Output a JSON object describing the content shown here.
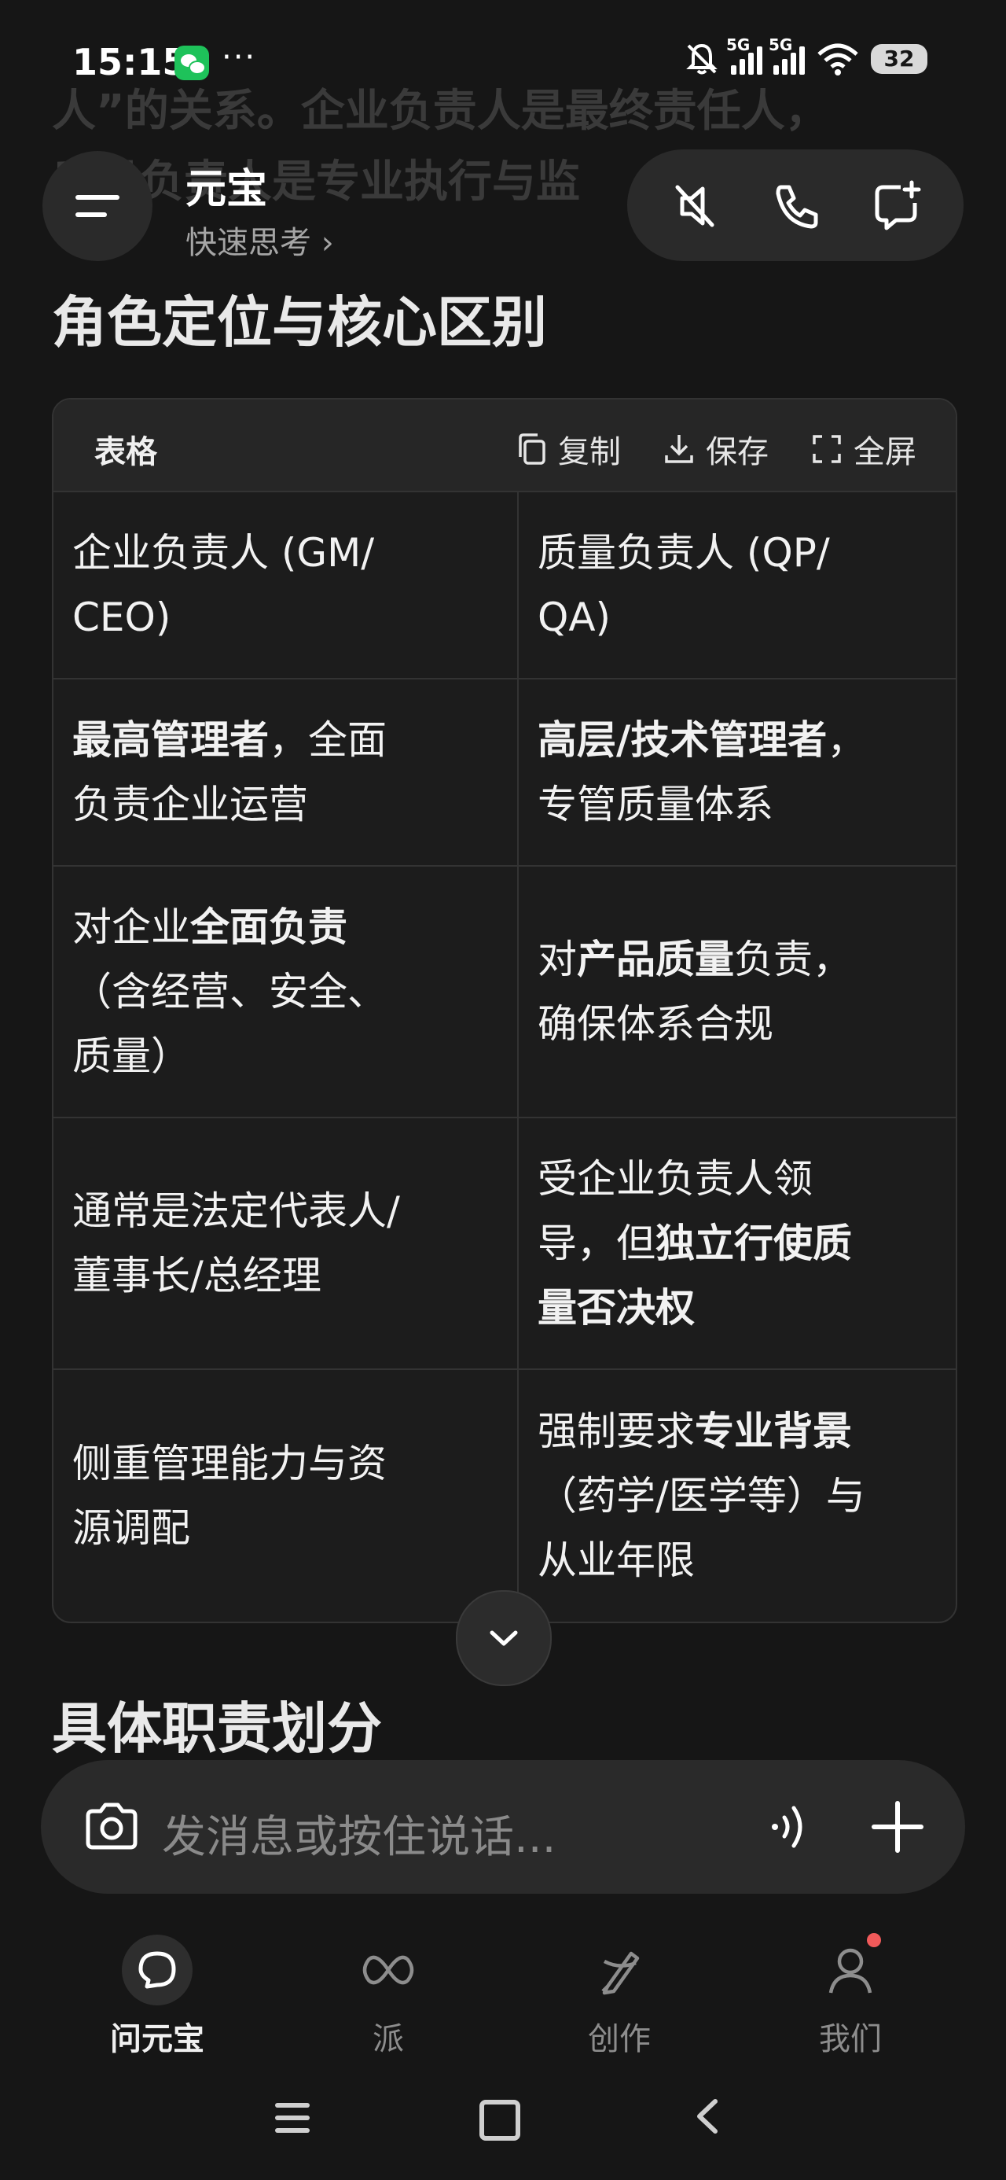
{
  "status_bar": {
    "time": "15:15",
    "more": "···",
    "signal1_tag": "5G",
    "signal2_tag": "5G",
    "battery": "32",
    "icons": [
      "wechat-icon",
      "mute-bell-icon",
      "signal-icon",
      "wifi-icon",
      "battery-icon"
    ]
  },
  "background_text": {
    "line1": "人”的关系。企业负责人是最终责任人，",
    "line2": "质量负责人是专业执行与监"
  },
  "header": {
    "title": "元宝",
    "mode": "快速思考 ›",
    "icons": [
      "menu-icon",
      "mute-speaker-icon",
      "phone-icon",
      "new-chat-icon"
    ]
  },
  "section1": {
    "heading": "角色定位与核心区别"
  },
  "table": {
    "label": "表格",
    "copy_label": "复制",
    "save_label": "保存",
    "fullscreen_label": "全屏",
    "rows": [
      {
        "c1": [
          {
            "t": "企业负责人 (GM/",
            "b": false
          },
          {
            "t": "CEO)",
            "b": false,
            "br": true
          }
        ],
        "c2": [
          {
            "t": "质量负责人 (QP/",
            "b": false
          },
          {
            "t": "QA)",
            "b": false,
            "br": true
          }
        ]
      },
      {
        "c1": [
          {
            "t": "最高管理者",
            "b": true
          },
          {
            "t": "，全面",
            "b": false
          },
          {
            "t": "负责企业运营",
            "b": false,
            "br": true
          }
        ],
        "c2": [
          {
            "t": "高层/技术管理者",
            "b": true
          },
          {
            "t": "，",
            "b": false
          },
          {
            "t": "专管质量体系",
            "b": false,
            "br": true
          }
        ]
      },
      {
        "c1": [
          {
            "t": "对企业",
            "b": false
          },
          {
            "t": "全面负责",
            "b": true
          },
          {
            "t": "（含经营、安全、",
            "b": false,
            "br": true
          },
          {
            "t": "质量）",
            "b": false,
            "br": true
          }
        ],
        "c2": [
          {
            "t": "对",
            "b": false
          },
          {
            "t": "产品质量",
            "b": true
          },
          {
            "t": "负责，",
            "b": false
          },
          {
            "t": "确保体系合规",
            "b": false,
            "br": true
          }
        ]
      },
      {
        "c1": [
          {
            "t": "通常是法定代表人/",
            "b": false
          },
          {
            "t": "董事长/总经理",
            "b": false,
            "br": true
          }
        ],
        "c2": [
          {
            "t": "受企业负责人领",
            "b": false
          },
          {
            "t": "导，但",
            "b": false,
            "br": true
          },
          {
            "t": "独立行使质",
            "b": true
          },
          {
            "t": "量否决权",
            "b": true,
            "br": true
          }
        ]
      },
      {
        "c1": [
          {
            "t": "侧重管理能力与资",
            "b": false
          },
          {
            "t": "源调配",
            "b": false,
            "br": true
          }
        ],
        "c2": [
          {
            "t": "强制要求",
            "b": false
          },
          {
            "t": "专业背景",
            "b": true
          },
          {
            "t": "（药学/医学等）与",
            "b": false,
            "br": true
          },
          {
            "t": "从业年限",
            "b": false,
            "br": true
          }
        ]
      }
    ]
  },
  "section2": {
    "heading": "具体职责划分"
  },
  "input": {
    "placeholder": "发消息或按住说话...",
    "icons": [
      "camera-icon",
      "voice-wave-icon",
      "plus-icon"
    ]
  },
  "bottom_nav": {
    "items": [
      {
        "label": "问元宝",
        "icon": "chat-bubble-icon",
        "active": true
      },
      {
        "label": "派",
        "icon": "infinity-icon",
        "active": false
      },
      {
        "label": "创作",
        "icon": "pen-star-icon",
        "active": false
      },
      {
        "label": "我们",
        "icon": "person-icon",
        "active": false,
        "badge": true
      }
    ]
  },
  "colors": {
    "background": "#161616",
    "card": "#1c1c1c",
    "badge": "#f05a5a",
    "wechat": "#1ec25a"
  }
}
